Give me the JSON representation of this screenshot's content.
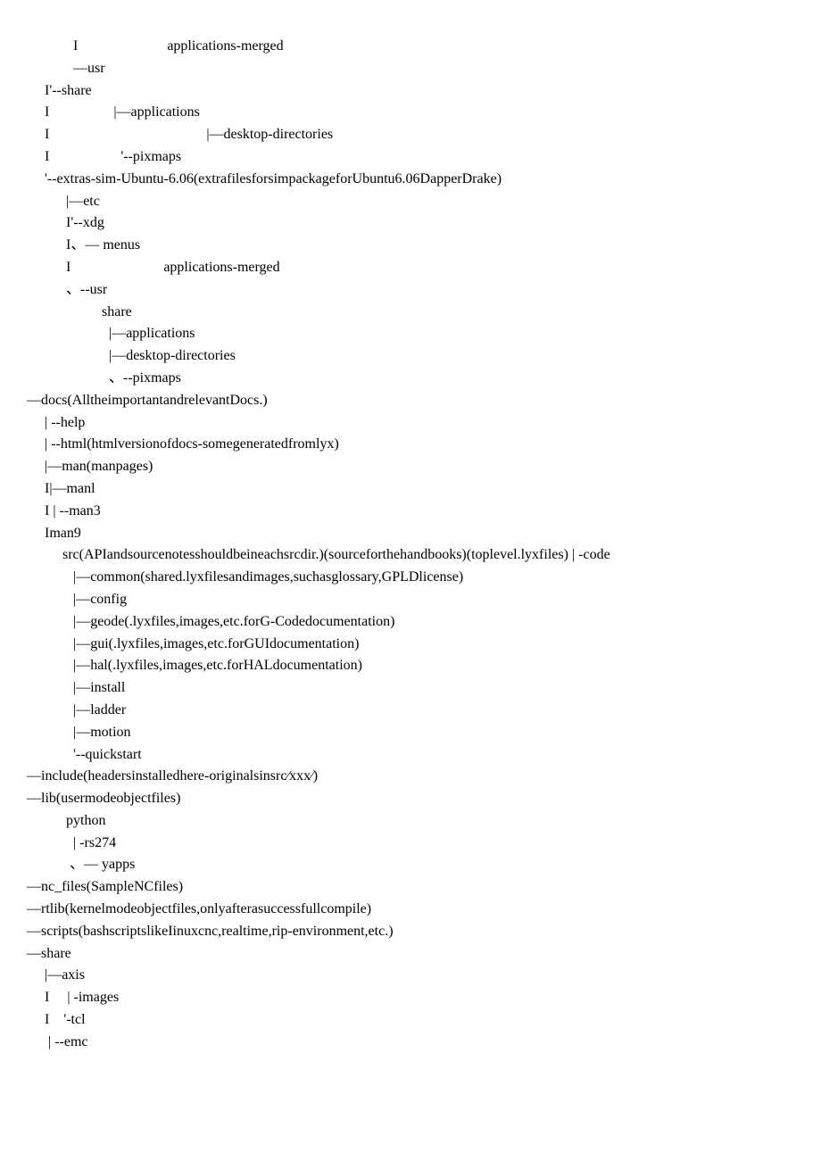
{
  "lines": [
    "             I                         applications-merged",
    "             —usr",
    "     I'--share",
    "     I                  |—applications",
    "     I                                            |—desktop-directories",
    "     I                    '--pixmaps",
    "     '--extras-sim-Ubuntu-6.06(extrafilesforsimpackageforUbuntu6.06DapperDrake)",
    "           |—etc",
    "           I'--xdg",
    "           I、— menus",
    "           I                          applications-merged",
    "           、--usr",
    "                     share",
    "                       |—applications",
    "                       |—desktop-directories",
    "                       、--pixmaps",
    "—docs(AlltheimportantandrelevantDocs.)",
    "     | --help",
    "     | --html(htmlversionofdocs-somegeneratedfromlyx)",
    "     |—man(manpages)",
    "     I|—manl",
    "     I | --man3",
    "     Iman9",
    "          src(APIandsourcenotesshouldbeineachsrcdir.)(sourceforthehandbooks)(toplevel.lyxfiles) | -code",
    "             |—common(shared.lyxfilesandimages,suchasglossary,GPLDlicense)",
    "             |—config",
    "             |—geode(.lyxfiles,images,etc.forG-Codedocumentation)",
    "             |—gui(.lyxfiles,images,etc.forGUIdocumentation)",
    "             |—hal(.lyxfiles,images,etc.forHALdocumentation)",
    "             |—install",
    "             |—ladder",
    "             |—motion",
    "             '--quickstart",
    "—include(headersinstalledhere-originalsinsrc⁄xxx⁄)",
    "—lib(usermodeobjectfiles)",
    "           python",
    "             | -rs274",
    "            、— yapps",
    "—nc_files(SampleNCfiles)",
    "—rtlib(kernelmodeobjectfiles,onlyafterasuccessfullcompile)",
    "—scripts(bashscriptslikeIinuxcnc,realtime,rip-environment,etc.)",
    "—share",
    "     |—axis",
    "     I     | -images",
    "     I    '-tcl",
    "      | --emc"
  ]
}
